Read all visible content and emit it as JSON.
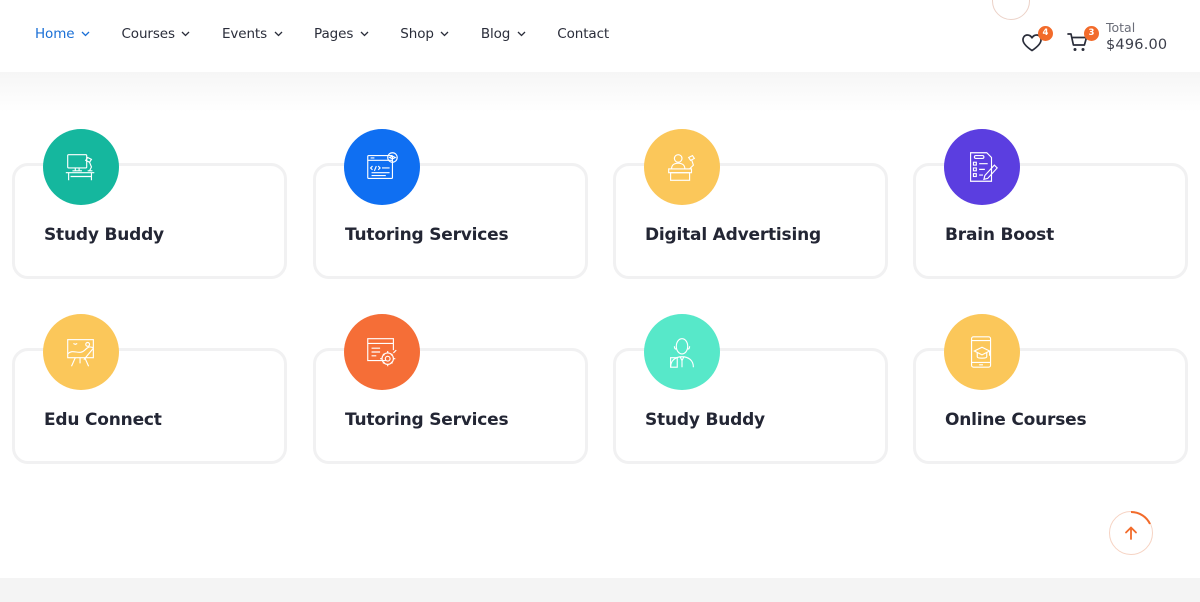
{
  "nav": {
    "items": [
      {
        "label": "Home",
        "active": true,
        "has_dropdown": true
      },
      {
        "label": "Courses",
        "active": false,
        "has_dropdown": true
      },
      {
        "label": "Events",
        "active": false,
        "has_dropdown": true
      },
      {
        "label": "Pages",
        "active": false,
        "has_dropdown": true
      },
      {
        "label": "Shop",
        "active": false,
        "has_dropdown": true
      },
      {
        "label": "Blog",
        "active": false,
        "has_dropdown": true
      },
      {
        "label": "Contact",
        "active": false,
        "has_dropdown": false
      }
    ]
  },
  "header": {
    "wishlist": {
      "icon": "heart-icon",
      "count": "4"
    },
    "cart": {
      "icon": "cart-icon",
      "count": "3"
    },
    "total_label": "Total",
    "total_value": "$496.00"
  },
  "colors": {
    "accent": "#1a6fd6",
    "badge": "#f26b2b",
    "teal": "#15b79e",
    "blue": "#0f6ff2",
    "yellow": "#fbc75a",
    "purple": "#5b3ee0",
    "orange": "#f56e37",
    "mint": "#57e8c9"
  },
  "services": [
    {
      "title": "Study Buddy",
      "icon": "desk-computer-icon",
      "color": "#15b79e"
    },
    {
      "title": "Tutoring Services",
      "icon": "code-window-icon",
      "color": "#0f6ff2"
    },
    {
      "title": "Digital Advertising",
      "icon": "teacher-desk-icon",
      "color": "#fbc75a"
    },
    {
      "title": "Brain Boost",
      "icon": "checklist-pencil-icon",
      "color": "#5b3ee0"
    },
    {
      "title": "Edu Connect",
      "icon": "easel-painting-icon",
      "color": "#fbc75a"
    },
    {
      "title": "Tutoring Services",
      "icon": "document-gear-icon",
      "color": "#f56e37"
    },
    {
      "title": "Study Buddy",
      "icon": "tutor-person-icon",
      "color": "#57e8c9"
    },
    {
      "title": "Online Courses",
      "icon": "tablet-graduation-cap-icon",
      "color": "#fbc75a"
    }
  ],
  "scroll_top": {
    "icon": "arrow-up-icon"
  }
}
